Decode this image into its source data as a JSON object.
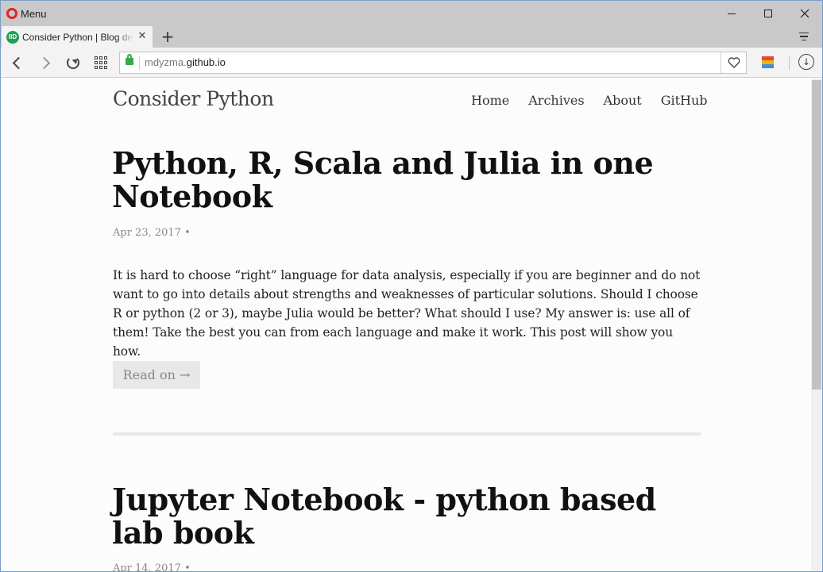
{
  "browser": {
    "menu_label": "Menu",
    "tab": {
      "title": "Consider Python | Blog dedicated to data science",
      "favicon_text": "IID"
    },
    "new_tab_symbol": "+",
    "address": {
      "domain_prefix": "mdyzma.",
      "domain_main": "github.io"
    },
    "icons": {
      "back": "back-arrow-icon",
      "forward": "forward-arrow-icon",
      "reload": "reload-icon",
      "speed_dial": "speed-dial-grid-icon",
      "secure": "lock-icon",
      "bookmark": "heart-icon",
      "download": "download-icon"
    },
    "colors": {
      "secure_lock": "#3aa84a",
      "opera_red": "#e0222a",
      "favicon_green": "#1f9e55"
    }
  },
  "site": {
    "title": "Consider Python",
    "nav": [
      "Home",
      "Archives",
      "About",
      "GitHub"
    ]
  },
  "posts": [
    {
      "title": "Python, R, Scala and Julia in one Notebook",
      "date": "Apr 23, 2017 •",
      "excerpt": "It is hard to choose “right” language for data analysis, especially if you are beginner and do not want to go into details about strengths and weaknesses of particular solutions. Should I choose R or python (2 or 3), maybe Julia would be better? What should I use? My answer is: use all of them! Take the best you can from each language and make it work. This post will show you how.",
      "read_on": "Read on →"
    },
    {
      "title": "Jupyter Notebook - python based lab book",
      "date": "Apr 14, 2017 •"
    }
  ]
}
